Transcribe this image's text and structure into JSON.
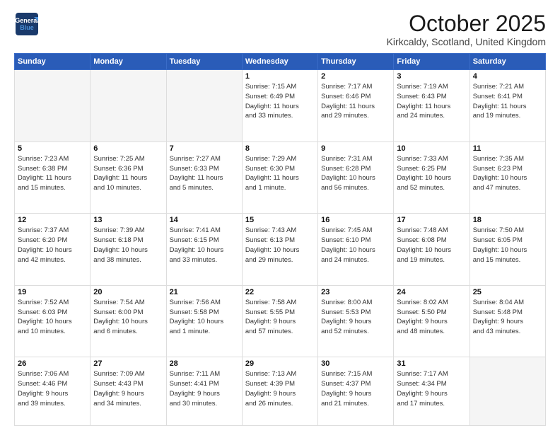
{
  "header": {
    "logo_line1": "General",
    "logo_line2": "Blue",
    "month": "October 2025",
    "location": "Kirkcaldy, Scotland, United Kingdom"
  },
  "weekdays": [
    "Sunday",
    "Monday",
    "Tuesday",
    "Wednesday",
    "Thursday",
    "Friday",
    "Saturday"
  ],
  "weeks": [
    [
      {
        "day": "",
        "info": ""
      },
      {
        "day": "",
        "info": ""
      },
      {
        "day": "",
        "info": ""
      },
      {
        "day": "1",
        "info": "Sunrise: 7:15 AM\nSunset: 6:49 PM\nDaylight: 11 hours\nand 33 minutes."
      },
      {
        "day": "2",
        "info": "Sunrise: 7:17 AM\nSunset: 6:46 PM\nDaylight: 11 hours\nand 29 minutes."
      },
      {
        "day": "3",
        "info": "Sunrise: 7:19 AM\nSunset: 6:43 PM\nDaylight: 11 hours\nand 24 minutes."
      },
      {
        "day": "4",
        "info": "Sunrise: 7:21 AM\nSunset: 6:41 PM\nDaylight: 11 hours\nand 19 minutes."
      }
    ],
    [
      {
        "day": "5",
        "info": "Sunrise: 7:23 AM\nSunset: 6:38 PM\nDaylight: 11 hours\nand 15 minutes."
      },
      {
        "day": "6",
        "info": "Sunrise: 7:25 AM\nSunset: 6:36 PM\nDaylight: 11 hours\nand 10 minutes."
      },
      {
        "day": "7",
        "info": "Sunrise: 7:27 AM\nSunset: 6:33 PM\nDaylight: 11 hours\nand 5 minutes."
      },
      {
        "day": "8",
        "info": "Sunrise: 7:29 AM\nSunset: 6:30 PM\nDaylight: 11 hours\nand 1 minute."
      },
      {
        "day": "9",
        "info": "Sunrise: 7:31 AM\nSunset: 6:28 PM\nDaylight: 10 hours\nand 56 minutes."
      },
      {
        "day": "10",
        "info": "Sunrise: 7:33 AM\nSunset: 6:25 PM\nDaylight: 10 hours\nand 52 minutes."
      },
      {
        "day": "11",
        "info": "Sunrise: 7:35 AM\nSunset: 6:23 PM\nDaylight: 10 hours\nand 47 minutes."
      }
    ],
    [
      {
        "day": "12",
        "info": "Sunrise: 7:37 AM\nSunset: 6:20 PM\nDaylight: 10 hours\nand 42 minutes."
      },
      {
        "day": "13",
        "info": "Sunrise: 7:39 AM\nSunset: 6:18 PM\nDaylight: 10 hours\nand 38 minutes."
      },
      {
        "day": "14",
        "info": "Sunrise: 7:41 AM\nSunset: 6:15 PM\nDaylight: 10 hours\nand 33 minutes."
      },
      {
        "day": "15",
        "info": "Sunrise: 7:43 AM\nSunset: 6:13 PM\nDaylight: 10 hours\nand 29 minutes."
      },
      {
        "day": "16",
        "info": "Sunrise: 7:45 AM\nSunset: 6:10 PM\nDaylight: 10 hours\nand 24 minutes."
      },
      {
        "day": "17",
        "info": "Sunrise: 7:48 AM\nSunset: 6:08 PM\nDaylight: 10 hours\nand 19 minutes."
      },
      {
        "day": "18",
        "info": "Sunrise: 7:50 AM\nSunset: 6:05 PM\nDaylight: 10 hours\nand 15 minutes."
      }
    ],
    [
      {
        "day": "19",
        "info": "Sunrise: 7:52 AM\nSunset: 6:03 PM\nDaylight: 10 hours\nand 10 minutes."
      },
      {
        "day": "20",
        "info": "Sunrise: 7:54 AM\nSunset: 6:00 PM\nDaylight: 10 hours\nand 6 minutes."
      },
      {
        "day": "21",
        "info": "Sunrise: 7:56 AM\nSunset: 5:58 PM\nDaylight: 10 hours\nand 1 minute."
      },
      {
        "day": "22",
        "info": "Sunrise: 7:58 AM\nSunset: 5:55 PM\nDaylight: 9 hours\nand 57 minutes."
      },
      {
        "day": "23",
        "info": "Sunrise: 8:00 AM\nSunset: 5:53 PM\nDaylight: 9 hours\nand 52 minutes."
      },
      {
        "day": "24",
        "info": "Sunrise: 8:02 AM\nSunset: 5:50 PM\nDaylight: 9 hours\nand 48 minutes."
      },
      {
        "day": "25",
        "info": "Sunrise: 8:04 AM\nSunset: 5:48 PM\nDaylight: 9 hours\nand 43 minutes."
      }
    ],
    [
      {
        "day": "26",
        "info": "Sunrise: 7:06 AM\nSunset: 4:46 PM\nDaylight: 9 hours\nand 39 minutes."
      },
      {
        "day": "27",
        "info": "Sunrise: 7:09 AM\nSunset: 4:43 PM\nDaylight: 9 hours\nand 34 minutes."
      },
      {
        "day": "28",
        "info": "Sunrise: 7:11 AM\nSunset: 4:41 PM\nDaylight: 9 hours\nand 30 minutes."
      },
      {
        "day": "29",
        "info": "Sunrise: 7:13 AM\nSunset: 4:39 PM\nDaylight: 9 hours\nand 26 minutes."
      },
      {
        "day": "30",
        "info": "Sunrise: 7:15 AM\nSunset: 4:37 PM\nDaylight: 9 hours\nand 21 minutes."
      },
      {
        "day": "31",
        "info": "Sunrise: 7:17 AM\nSunset: 4:34 PM\nDaylight: 9 hours\nand 17 minutes."
      },
      {
        "day": "",
        "info": ""
      }
    ]
  ]
}
